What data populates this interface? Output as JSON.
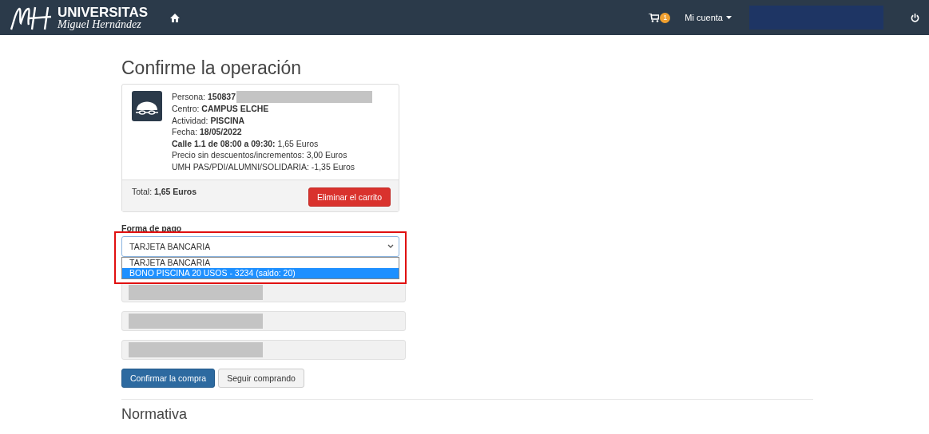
{
  "navbar": {
    "brand": {
      "title": "UNIVERSITAS",
      "subtitle": "Miguel Hernández"
    },
    "cart_count": "1",
    "account_label": "Mi cuenta"
  },
  "page_title": "Confirme la operación",
  "cart": {
    "lines": [
      "Persona: **150837**",
      "Centro: **CAMPUS ELCHE**",
      "Actividad: **PISCINA**",
      "Fecha: **18/05/2022**",
      "**Calle 1.1 de 08:00 a 09:30:** 1,65 Euros",
      "Precio sin descuentos/incrementos: 3,00 Euros",
      "UMH PAS/PDI/ALUMNI/SOLIDARIA: -1,35 Euros"
    ],
    "total": "Total:  **1,65 Euros**",
    "remove_button": "Eliminar el carrito"
  },
  "payment": {
    "label": "Forma de pago",
    "value": "TARJETA BANCARIA",
    "options": [
      {
        "label": "TARJETA BANCARIA",
        "highlighted": false
      },
      {
        "label": "BONO PISCINA 20 USOS - 3234 (saldo: 20)",
        "highlighted": true
      }
    ]
  },
  "buttons": [
    {
      "label": "Confirmar la compra",
      "kind": "primary"
    },
    {
      "label": "Seguir comprando",
      "kind": "default"
    }
  ],
  "section_title": "Normativa"
}
